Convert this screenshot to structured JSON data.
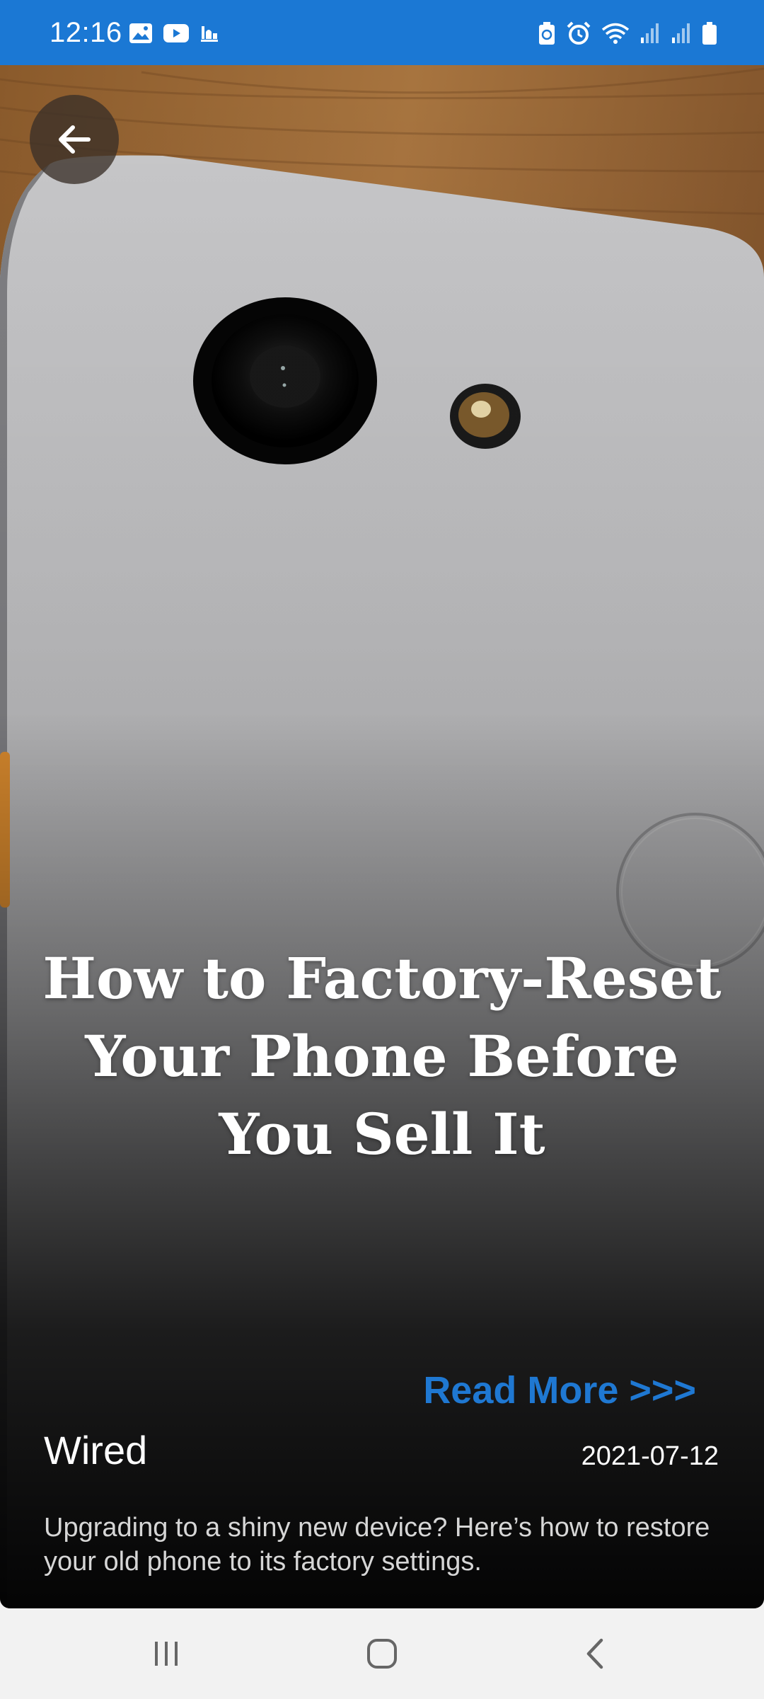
{
  "status_bar": {
    "time": "12:16",
    "left_icons": [
      "gallery-icon",
      "youtube-icon",
      "app-notification-icon"
    ],
    "right_icons": [
      "battery-saver-icon",
      "alarm-icon",
      "wifi-icon",
      "signal-icon",
      "signal-icon",
      "battery-icon"
    ],
    "background_color": "#1b78d4"
  },
  "article": {
    "back_icon": "arrow-left-icon",
    "title": "How to Factory-Reset Your Phone Before You Sell It",
    "read_more_label": "Read More >>>",
    "source": "Wired",
    "date": "2021-07-12",
    "description": "Upgrading to a shiny new device? Here’s how to restore your old phone to its factory settings.",
    "accent_color": "#1f78d2"
  },
  "nav_bar": {
    "buttons": [
      "recent-apps-icon",
      "home-icon",
      "back-icon"
    ]
  }
}
